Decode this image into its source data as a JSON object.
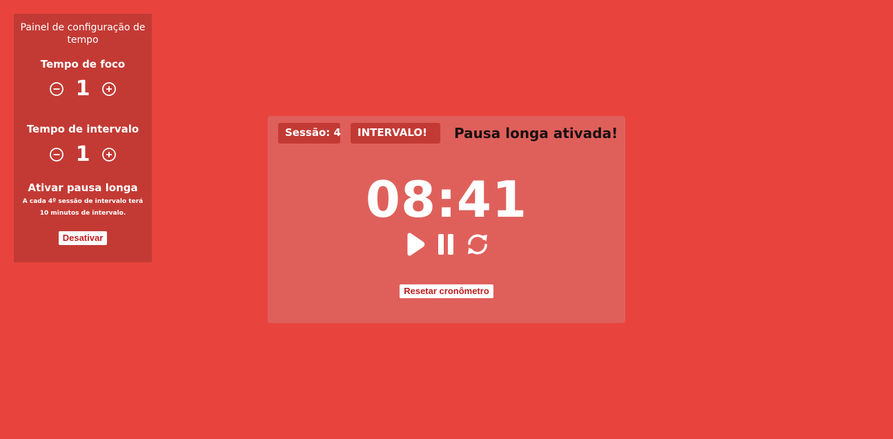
{
  "settings_panel": {
    "title": "Painel de configuração de tempo",
    "focus": {
      "label": "Tempo de foco",
      "value": "1"
    },
    "break": {
      "label": "Tempo de intervalo",
      "value": "1"
    },
    "long_break": {
      "label": "Ativar pausa longa",
      "description": "A cada 4º sessão de intervalo terá 10 minutos de intervalo.",
      "button_label": "Desativar"
    },
    "icons": {
      "decrement": "minus-circle-icon",
      "increment": "plus-circle-icon"
    }
  },
  "timer": {
    "session_label": "Sessão: 4",
    "mode_label": "INTERVALO!",
    "long_break_message": "Pausa longa ativada!",
    "time": "08:41",
    "controls": {
      "play": "play-icon",
      "pause": "pause-icon",
      "restart": "restart-icon"
    },
    "reset_button_label": "Resetar cronômetro"
  },
  "colors": {
    "background": "#e8443d",
    "panel": "#c33a34",
    "card": "#df605b",
    "button_text": "#c01c1c",
    "message_text": "#1a1010"
  }
}
